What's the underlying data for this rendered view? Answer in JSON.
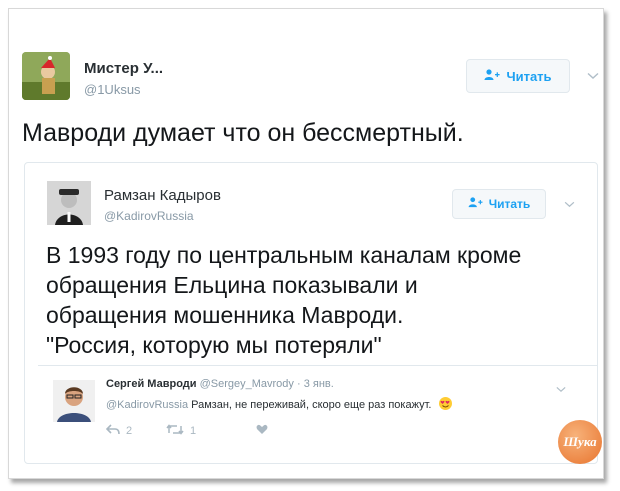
{
  "main_tweet": {
    "author_name": "Мистер У...",
    "author_handle": "@1Uksus",
    "follow_label": "Читать",
    "text": "Мавроди думает что он бессмертный."
  },
  "quoted_tweet": {
    "author_name": "Рамзан Кадыров",
    "author_handle": "@KadirovRussia",
    "follow_label": "Читать",
    "text_lines": [
      "В 1993 году по центральным каналам кроме",
      "обращения Ельцина показывали и",
      "обращения мошенника Мавроди.",
      "\"Россия, которую мы потеряли\""
    ]
  },
  "reply": {
    "author_name": "Сергей Мавроди",
    "author_handle": "@Sergey_Mavrody",
    "time": "3 янв.",
    "mention": "@KadirovRussia",
    "text": "Рамзан, не переживай, скоро еще раз покажут.",
    "emoji": "heart-eyes-emoji",
    "reply_count": "2",
    "retweet_count": "1"
  },
  "colors": {
    "accent": "#1da1f2",
    "muted": "#8899a6",
    "border": "#e1e8ed",
    "watermark": "#e8742e"
  },
  "watermark": {
    "text": "Шука"
  }
}
